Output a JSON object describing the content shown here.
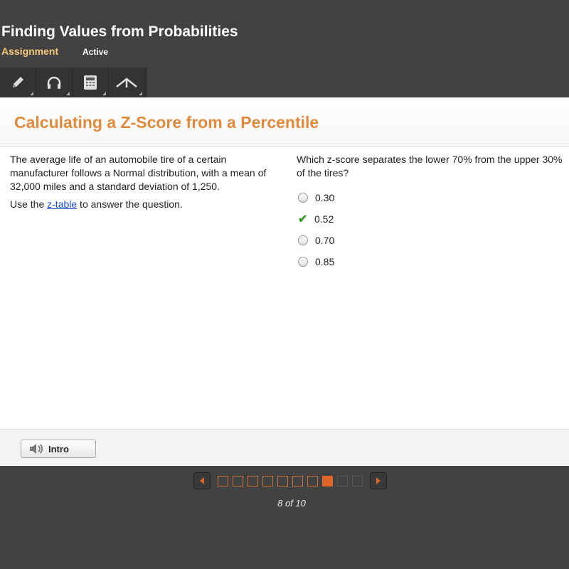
{
  "header": {
    "title": "Finding Values from Probabilities",
    "type": "Assignment",
    "status": "Active"
  },
  "toolbar": {
    "tools": [
      "pencil-icon",
      "headphones-icon",
      "calculator-icon",
      "reference-icon"
    ]
  },
  "lesson": {
    "title": "Calculating a Z-Score from a Percentile"
  },
  "passage": {
    "text": "The average life of an automobile tire of a certain manufacturer follows a Normal distribution, with a mean of 32,000 miles and a standard deviation of 1,250.",
    "use_prefix": "Use the ",
    "link": "z-table",
    "use_suffix": " to answer the question."
  },
  "question": {
    "text": "Which z-score separates the lower 70% from the upper 30% of the tires?",
    "options": [
      "0.30",
      "0.52",
      "0.70",
      "0.85"
    ],
    "selected": 1
  },
  "footer": {
    "intro_label": "Intro"
  },
  "pagination": {
    "current": 8,
    "total": 10,
    "label": "8 of 10"
  },
  "colors": {
    "accent": "#e08a3c",
    "current_page": "#e0652a",
    "correct": "#3a9a2a"
  }
}
